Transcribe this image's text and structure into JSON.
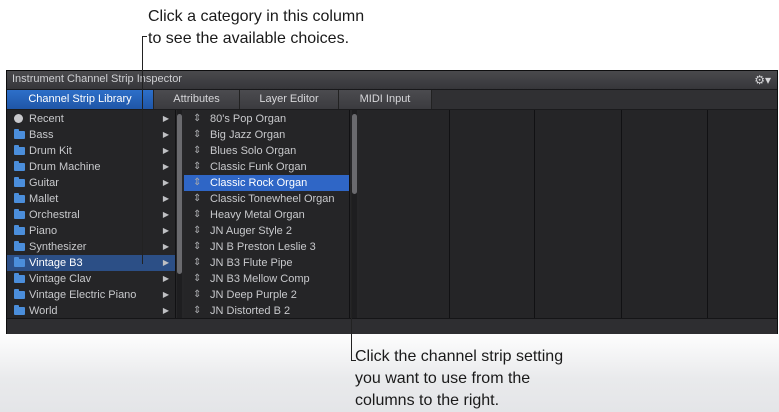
{
  "callouts": {
    "top_line1": "Click a category in this column",
    "top_line2": "to see the available choices.",
    "bottom_line1": "Click the channel strip setting",
    "bottom_line2": "you want to use from the",
    "bottom_line3": "columns to the right."
  },
  "window": {
    "title": "Instrument Channel Strip Inspector",
    "gear_icon": "⚙▾"
  },
  "tabs": [
    {
      "label": "Channel Strip Library",
      "active": true
    },
    {
      "label": "Attributes",
      "active": false
    },
    {
      "label": "Layer Editor",
      "active": false
    },
    {
      "label": "MIDI Input",
      "active": false
    }
  ],
  "categories": [
    {
      "label": "Recent",
      "icon": "recent-icon",
      "arrow": "▶"
    },
    {
      "label": "Bass",
      "icon": "folder-icon",
      "arrow": "▶"
    },
    {
      "label": "Drum Kit",
      "icon": "folder-icon",
      "arrow": "▶"
    },
    {
      "label": "Drum Machine",
      "icon": "folder-icon",
      "arrow": "▶"
    },
    {
      "label": "Guitar",
      "icon": "folder-icon",
      "arrow": "▶"
    },
    {
      "label": "Mallet",
      "icon": "folder-icon",
      "arrow": "▶"
    },
    {
      "label": "Orchestral",
      "icon": "folder-icon",
      "arrow": "▶"
    },
    {
      "label": "Piano",
      "icon": "folder-icon",
      "arrow": "▶"
    },
    {
      "label": "Synthesizer",
      "icon": "folder-icon",
      "arrow": "▶"
    },
    {
      "label": "Vintage B3",
      "icon": "folder-icon",
      "arrow": "▶",
      "selected": true
    },
    {
      "label": "Vintage Clav",
      "icon": "folder-icon",
      "arrow": "▶"
    },
    {
      "label": "Vintage Electric Piano",
      "icon": "folder-icon",
      "arrow": "▶"
    },
    {
      "label": "World",
      "icon": "folder-icon",
      "arrow": "▶"
    }
  ],
  "settings": [
    {
      "label": "80's Pop Organ",
      "icon_glyph": "⇕"
    },
    {
      "label": "Big Jazz Organ",
      "icon_glyph": "⇕"
    },
    {
      "label": "Blues Solo Organ",
      "icon_glyph": "⇕"
    },
    {
      "label": "Classic Funk Organ",
      "icon_glyph": "⇕"
    },
    {
      "label": "Classic Rock Organ",
      "icon_glyph": "⇕",
      "selected": true
    },
    {
      "label": "Classic Tonewheel Organ",
      "icon_glyph": "⇕"
    },
    {
      "label": "Heavy Metal Organ",
      "icon_glyph": "⇕"
    },
    {
      "label": "JN Auger Style 2",
      "icon_glyph": "⇕"
    },
    {
      "label": "JN B Preston Leslie 3",
      "icon_glyph": "⇕"
    },
    {
      "label": "JN B3 Flute Pipe",
      "icon_glyph": "⇕"
    },
    {
      "label": "JN B3 Mellow Comp",
      "icon_glyph": "⇕"
    },
    {
      "label": "JN Deep Purple 2",
      "icon_glyph": "⇕"
    },
    {
      "label": "JN Distorted B 2",
      "icon_glyph": "⇕"
    }
  ],
  "colors": {
    "accent_tab": "#2d6fc9",
    "selected_category": "#2c4f86",
    "selected_setting": "#2f66c6",
    "folder": "#4b8edb"
  }
}
